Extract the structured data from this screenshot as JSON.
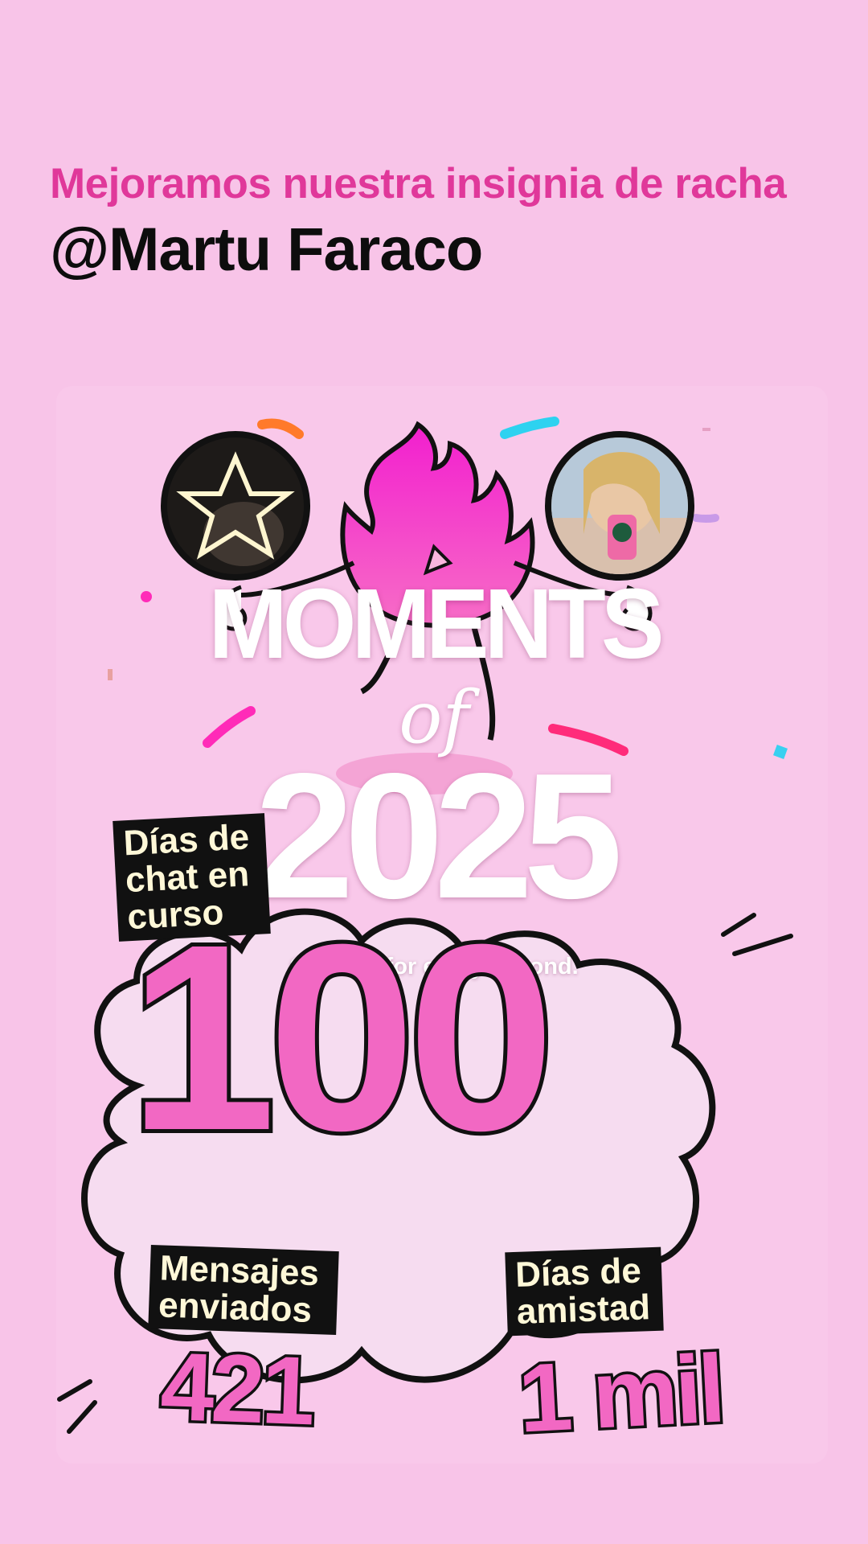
{
  "header": {
    "subtitle": "Mejoramos nuestra insignia de racha",
    "handle": "@Martu Faraco"
  },
  "overlay": {
    "word": "MOMENTS",
    "of": "of",
    "year": "2025",
    "tagline": "Grateful for every second."
  },
  "streak": {
    "label": "Días de chat en curso",
    "value": "100"
  },
  "stats": {
    "messages_label": "Mensajes enviados",
    "messages_value": "421",
    "friendship_label": "Días de amistad",
    "friendship_value": "1 mil"
  },
  "colors": {
    "background": "#f8c4e8",
    "accent_pink": "#e0389a",
    "number_pink": "#f268c3",
    "flame": "#e93ad7"
  },
  "icons": [
    "star-avatar",
    "user-photo-avatar",
    "flame-mascot-icon",
    "cloud-shape",
    "confetti"
  ]
}
